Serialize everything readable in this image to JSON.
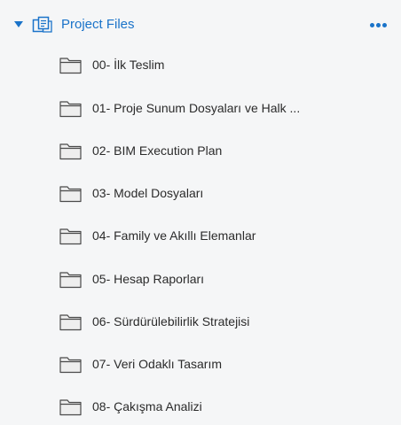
{
  "project": {
    "title": "Project Files",
    "expand_icon": "caret-down-icon",
    "icon": "project-files-icon",
    "more_icon": "more-horizontal-icon",
    "accent_color": "#1a73c9"
  },
  "folders": [
    {
      "label": "00- İlk Teslim",
      "icon": "folder-icon"
    },
    {
      "label": "01- Proje Sunum Dosyaları ve Halk ...",
      "icon": "folder-icon"
    },
    {
      "label": "02- BIM Execution Plan",
      "icon": "folder-icon"
    },
    {
      "label": "03- Model Dosyaları",
      "icon": "folder-icon"
    },
    {
      "label": "04- Family ve Akıllı Elemanlar",
      "icon": "folder-icon"
    },
    {
      "label": "05- Hesap Raporları",
      "icon": "folder-icon"
    },
    {
      "label": "06- Sürdürülebilirlik Stratejisi",
      "icon": "folder-icon"
    },
    {
      "label": "07- Veri Odaklı Tasarım",
      "icon": "folder-icon"
    },
    {
      "label": "08- Çakışma Analizi",
      "icon": "folder-icon"
    }
  ]
}
